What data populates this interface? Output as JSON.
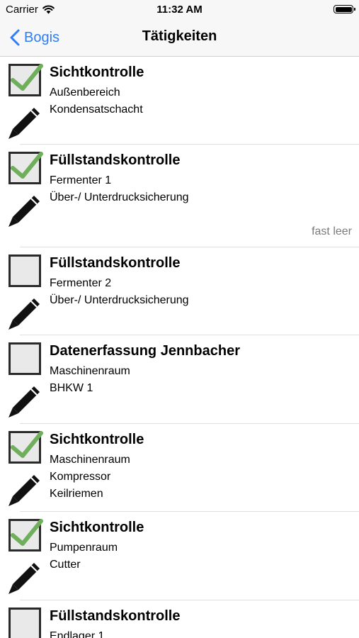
{
  "status_bar": {
    "carrier": "Carrier",
    "time": "11:32 AM"
  },
  "nav": {
    "back_label": "Bogis",
    "title": "Tätigkeiten"
  },
  "colors": {
    "accent": "#2f7ef6",
    "check": "#6fae5a"
  },
  "tasks": [
    {
      "title": "Sichtkontrolle",
      "lines": [
        "Außenbereich",
        "Kondensatschacht"
      ],
      "checked": true,
      "note": ""
    },
    {
      "title": "Füllstandskontrolle",
      "lines": [
        "Fermenter 1",
        "Über-/ Unterdrucksicherung"
      ],
      "checked": true,
      "note": "fast leer"
    },
    {
      "title": "Füllstandskontrolle",
      "lines": [
        "Fermenter 2",
        "Über-/ Unterdrucksicherung"
      ],
      "checked": false,
      "note": ""
    },
    {
      "title": "Datenerfassung Jennbacher",
      "lines": [
        "Maschinenraum",
        "BHKW 1"
      ],
      "checked": false,
      "note": ""
    },
    {
      "title": "Sichtkontrolle",
      "lines": [
        "Maschinenraum",
        "Kompressor",
        "Keilriemen"
      ],
      "checked": true,
      "note": ""
    },
    {
      "title": "Sichtkontrolle",
      "lines": [
        "Pumpenraum",
        "Cutter"
      ],
      "checked": true,
      "note": ""
    },
    {
      "title": "Füllstandskontrolle",
      "lines": [
        "Endlager 1"
      ],
      "checked": false,
      "note": ""
    }
  ]
}
